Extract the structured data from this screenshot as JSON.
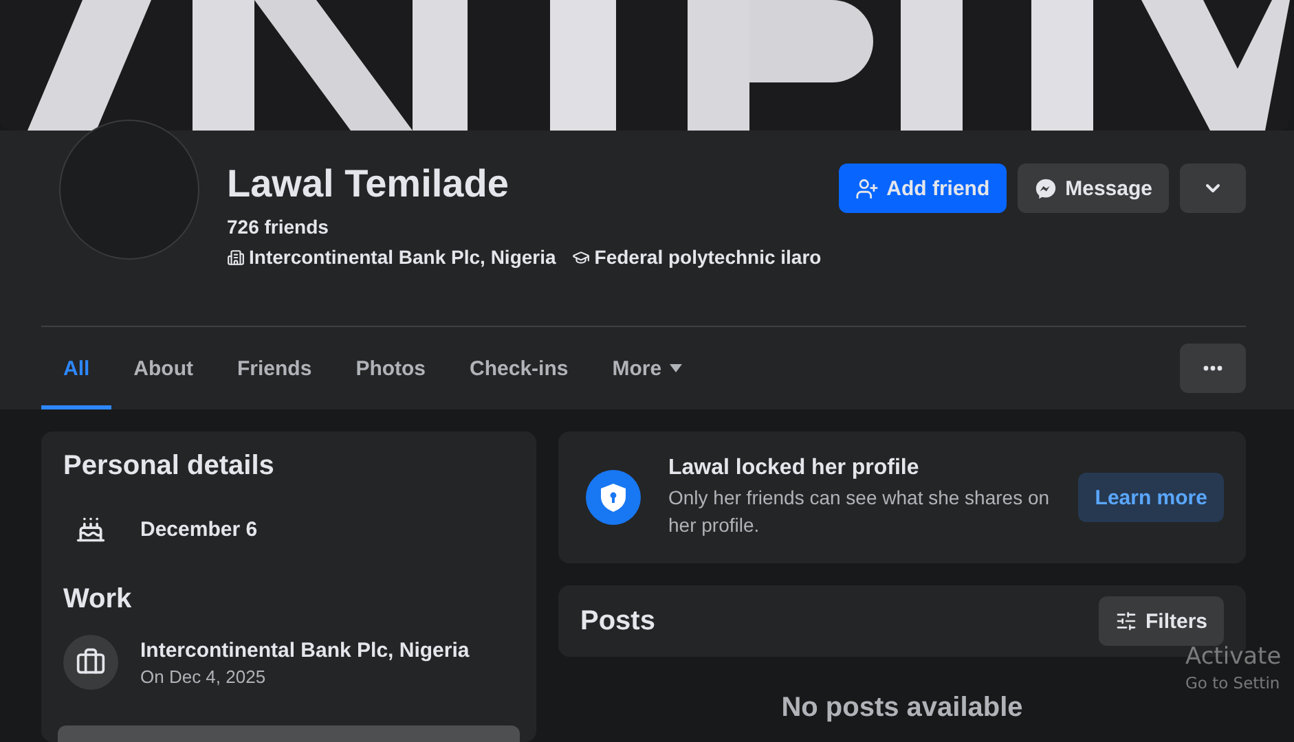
{
  "profile": {
    "name": "Lawal Temilade",
    "friends_count": "726 friends",
    "workplace": "Intercontinental Bank Plc, Nigeria",
    "school": "Federal polytechnic ilaro"
  },
  "actions": [
    {
      "kind": "add",
      "label": "Add friend"
    },
    {
      "kind": "message",
      "label": "Message"
    },
    {
      "kind": "more"
    }
  ],
  "tabs": [
    {
      "label": "All",
      "selected": true
    },
    {
      "label": "About",
      "selected": false
    },
    {
      "label": "Friends",
      "selected": false
    },
    {
      "label": "Photos",
      "selected": false
    },
    {
      "label": "Check-ins",
      "selected": false
    },
    {
      "label": "More",
      "selected": false,
      "dropdown": true
    }
  ],
  "personal_details": {
    "title": "Personal details",
    "birthday": "December 6"
  },
  "work": {
    "title": "Work",
    "employer": "Intercontinental Bank Plc, Nigeria",
    "date": "On Dec 4, 2025"
  },
  "locked_notice": {
    "title": "Lawal locked her profile",
    "text": "Only her friends can see what she shares on her profile.",
    "button": "Learn more"
  },
  "posts": {
    "title": "Posts",
    "filter_button": "Filters",
    "empty_text": "No posts available"
  },
  "os_watermark": {
    "title": "Activate",
    "subtitle": "Go to Settin"
  }
}
